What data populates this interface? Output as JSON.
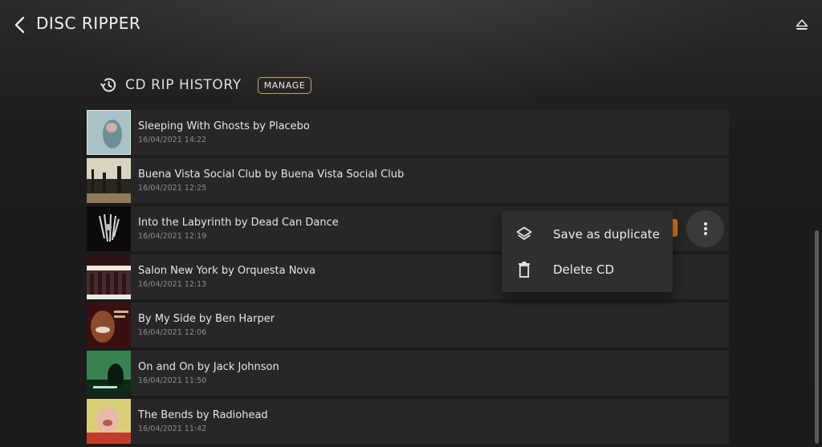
{
  "header": {
    "title": "DISC RIPPER",
    "back_icon": "chevron-left-icon",
    "eject_icon": "eject-icon"
  },
  "section": {
    "icon": "history-icon",
    "title": "CD RIP HISTORY",
    "manage_label": "MANAGE"
  },
  "rips": [
    {
      "title": "Sleeping With Ghosts by Placebo",
      "date": "16/04/2021 14:22"
    },
    {
      "title": "Buena Vista Social Club by Buena Vista Social Club",
      "date": "16/04/2021 12:25"
    },
    {
      "title": "Into the Labyrinth by Dead Can Dance",
      "date": "16/04/2021 12:19"
    },
    {
      "title": "Salon New York by Orquesta Nova",
      "date": "16/04/2021 12:13"
    },
    {
      "title": "By My Side by Ben Harper",
      "date": "16/04/2021 12:06"
    },
    {
      "title": "On and On by Jack Johnson",
      "date": "16/04/2021 11:50"
    },
    {
      "title": "The Bends by Radiohead",
      "date": "16/04/2021 11:42"
    }
  ],
  "context_menu": {
    "items": [
      {
        "label": "Save as duplicate",
        "icon": "layers-icon"
      },
      {
        "label": "Delete CD",
        "icon": "trash-icon"
      }
    ]
  },
  "colors": {
    "accent": "#e07a1a",
    "manage_border": "#c9a06a",
    "background": "#1c1c1c",
    "row": "#272727",
    "menu": "#2f2f2f"
  }
}
